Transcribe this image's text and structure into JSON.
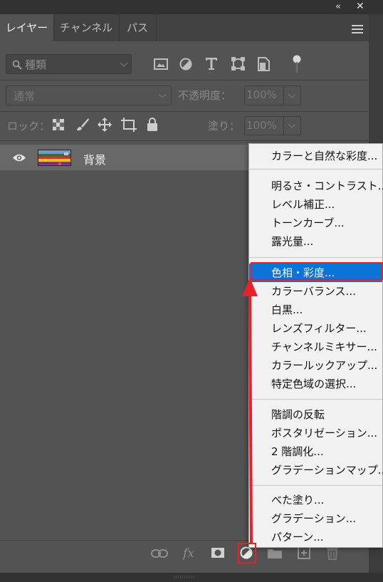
{
  "window": {
    "collapse_icon": "«",
    "close_icon": "✕"
  },
  "tabs": [
    {
      "label": "レイヤー"
    },
    {
      "label": "チャンネル"
    },
    {
      "label": "パス"
    }
  ],
  "filter": {
    "placeholder": "種類"
  },
  "blend": {
    "mode": "通常",
    "opacity_label": "不透明度：",
    "opacity_value": "100%"
  },
  "lock": {
    "label": "ロック：",
    "fill_label": "塗り：",
    "fill_value": "100%"
  },
  "layer": {
    "name": "背景"
  },
  "menu": {
    "groups": [
      [
        "カラーと自然な彩度..."
      ],
      [
        "明るさ・コントラスト...",
        "レベル補正...",
        "トーンカーブ...",
        "露光量..."
      ],
      [
        "色相・彩度...",
        "カラーバランス...",
        "白黒...",
        "レンズフィルター...",
        "チャンネルミキサー...",
        "カラールックアップ...",
        "特定色域の選択..."
      ],
      [
        "階調の反転",
        "ポスタリゼーション...",
        "2 階調化...",
        "グラデーションマップ..."
      ],
      [
        "べた塗り...",
        "グラデーション...",
        "パターン..."
      ]
    ],
    "selected": "色相・彩度..."
  },
  "colors": {
    "panel": "#535353",
    "selection": "#0a74d8",
    "annotation": "#e8202a"
  }
}
